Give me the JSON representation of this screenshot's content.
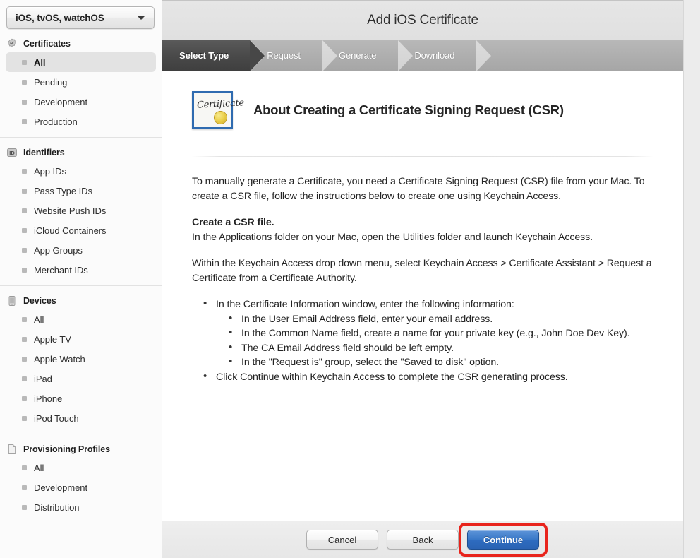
{
  "sidebar": {
    "team_select": {
      "value": "iOS, tvOS, watchOS",
      "arrow_icon": "chevron-down-icon"
    },
    "sections": [
      {
        "icon": "certificate-seal-icon",
        "label": "Certificates",
        "items": [
          {
            "label": "All",
            "selected": true
          },
          {
            "label": "Pending",
            "selected": false
          },
          {
            "label": "Development",
            "selected": false
          },
          {
            "label": "Production",
            "selected": false
          }
        ]
      },
      {
        "icon": "identifiers-id-icon",
        "label": "Identifiers",
        "items": [
          {
            "label": "App IDs",
            "selected": false
          },
          {
            "label": "Pass Type IDs",
            "selected": false
          },
          {
            "label": "Website Push IDs",
            "selected": false
          },
          {
            "label": "iCloud Containers",
            "selected": false
          },
          {
            "label": "App Groups",
            "selected": false
          },
          {
            "label": "Merchant IDs",
            "selected": false
          }
        ]
      },
      {
        "icon": "device-phone-icon",
        "label": "Devices",
        "items": [
          {
            "label": "All",
            "selected": false
          },
          {
            "label": "Apple TV",
            "selected": false
          },
          {
            "label": "Apple Watch",
            "selected": false
          },
          {
            "label": "iPad",
            "selected": false
          },
          {
            "label": "iPhone",
            "selected": false
          },
          {
            "label": "iPod Touch",
            "selected": false
          }
        ]
      },
      {
        "icon": "document-page-icon",
        "label": "Provisioning Profiles",
        "items": [
          {
            "label": "All",
            "selected": false
          },
          {
            "label": "Development",
            "selected": false
          },
          {
            "label": "Distribution",
            "selected": false
          }
        ]
      }
    ]
  },
  "panel": {
    "title": "Add iOS Certificate",
    "steps": [
      {
        "label": "Select Type",
        "state": "active"
      },
      {
        "label": "Request",
        "state": "upcoming"
      },
      {
        "label": "Generate",
        "state": "upcoming"
      },
      {
        "label": "Download",
        "state": "upcoming"
      }
    ],
    "doc": {
      "icon": "certificate-document-icon",
      "icon_word": "Certificate",
      "heading": "About Creating a Certificate Signing Request (CSR)",
      "paragraph1": "To manually generate a Certificate, you need a Certificate Signing Request (CSR) file from your Mac. To create a CSR file, follow the instructions below to create one using Keychain Access.",
      "subhead": "Create a CSR file.",
      "paragraph2": "In the Applications folder on your Mac, open the Utilities folder and launch Keychain Access.",
      "paragraph3": "Within the Keychain Access drop down menu, select Keychain Access > Certificate Assistant > Request a Certificate from a Certificate Authority.",
      "bullet1": "In the Certificate Information window, enter the following information:",
      "sub_bullets": [
        "In the User Email Address field, enter your email address.",
        "In the Common Name field, create a name for your private key (e.g., John Doe Dev Key).",
        "The CA Email Address field should be left empty.",
        "In the \"Request is\" group, select the \"Saved to disk\" option."
      ],
      "bullet2": "Click Continue within Keychain Access to complete the CSR generating process."
    },
    "footer": {
      "cancel_label": "Cancel",
      "back_label": "Back",
      "continue_label": "Continue",
      "highlight_color": "#e8241c",
      "primary_color": "#2e6cc0"
    }
  }
}
